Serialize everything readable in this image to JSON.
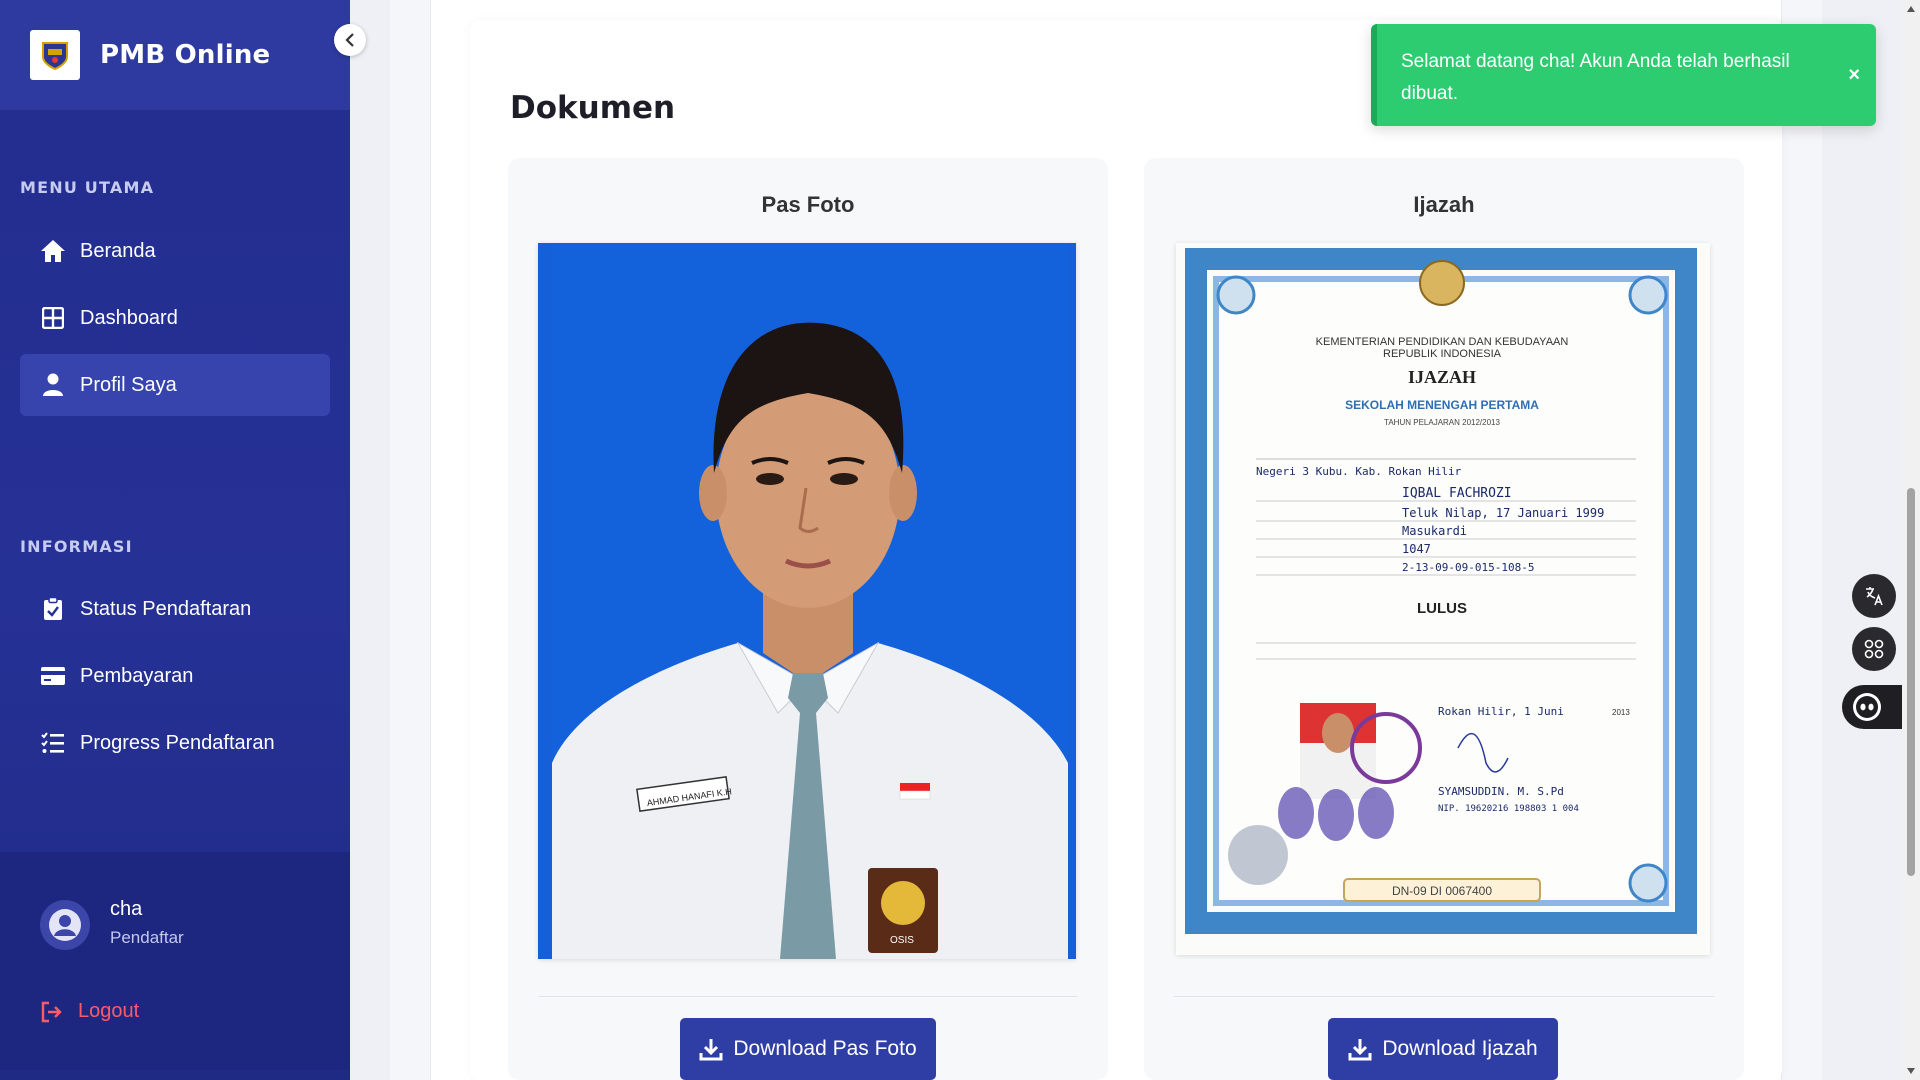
{
  "app": {
    "title": "PMB Online"
  },
  "sidebar": {
    "sections": [
      {
        "label": "MENU UTAMA"
      },
      {
        "label": "INFORMASI"
      }
    ],
    "items": [
      {
        "label": "Beranda",
        "icon": "home-icon"
      },
      {
        "label": "Dashboard",
        "icon": "dashboard-icon"
      },
      {
        "label": "Profil Saya",
        "icon": "user-icon",
        "active": true
      },
      {
        "label": "Status Pendaftaran",
        "icon": "clipboard-check-icon"
      },
      {
        "label": "Pembayaran",
        "icon": "credit-card-icon"
      },
      {
        "label": "Progress Pendaftaran",
        "icon": "list-check-icon"
      }
    ],
    "user": {
      "name": "cha",
      "role": "Pendaftar"
    },
    "logout_label": "Logout"
  },
  "main": {
    "section_title": "Dokumen",
    "documents": [
      {
        "title": "Pas Foto",
        "button_label": "Download Pas Foto"
      },
      {
        "title": "Ijazah",
        "button_label": "Download Ijazah"
      }
    ]
  },
  "ijazah": {
    "ministry": "KEMENTERIAN PENDIDIKAN DAN KEBUDAYAAN",
    "republic": "REPUBLIK INDONESIA",
    "heading": "IJAZAH",
    "school_level": "SEKOLAH MENENGAH PERTAMA",
    "year": "TAHUN PELAJARAN 2012/2013",
    "school": "Negeri 3 Kubu. Kab. Rokan Hilir",
    "name": "IQBAL FACHROZI",
    "birth": "Teluk Nilap, 17 Januari 1999",
    "parent": "Masukardi",
    "nis": "1047",
    "participant_no": "2-13-09-09-015-108-5",
    "status": "LULUS",
    "place_date": "Rokan Hilir, 1 Juni",
    "place_year": "2013",
    "signer": "SYAMSUDDIN. M. S.Pd",
    "nip": "NIP. 19620216 198803 1 004",
    "serial": "DN-09 DI 0067400"
  },
  "photo": {
    "name_tag": "AHMAD HANAFI K.H",
    "badge_text": "OSIS"
  },
  "toast": {
    "message": "Selamat datang cha! Akun Anda telah berhasil dibuat.",
    "close": "×"
  },
  "colors": {
    "sidebar_bg": "#232d8e",
    "active_item": "#3744ad",
    "primary_button": "#2f3ea5",
    "toast_bg": "#2ecc71",
    "logout": "#ff5a6a",
    "photo_bg": "#1560d9"
  }
}
